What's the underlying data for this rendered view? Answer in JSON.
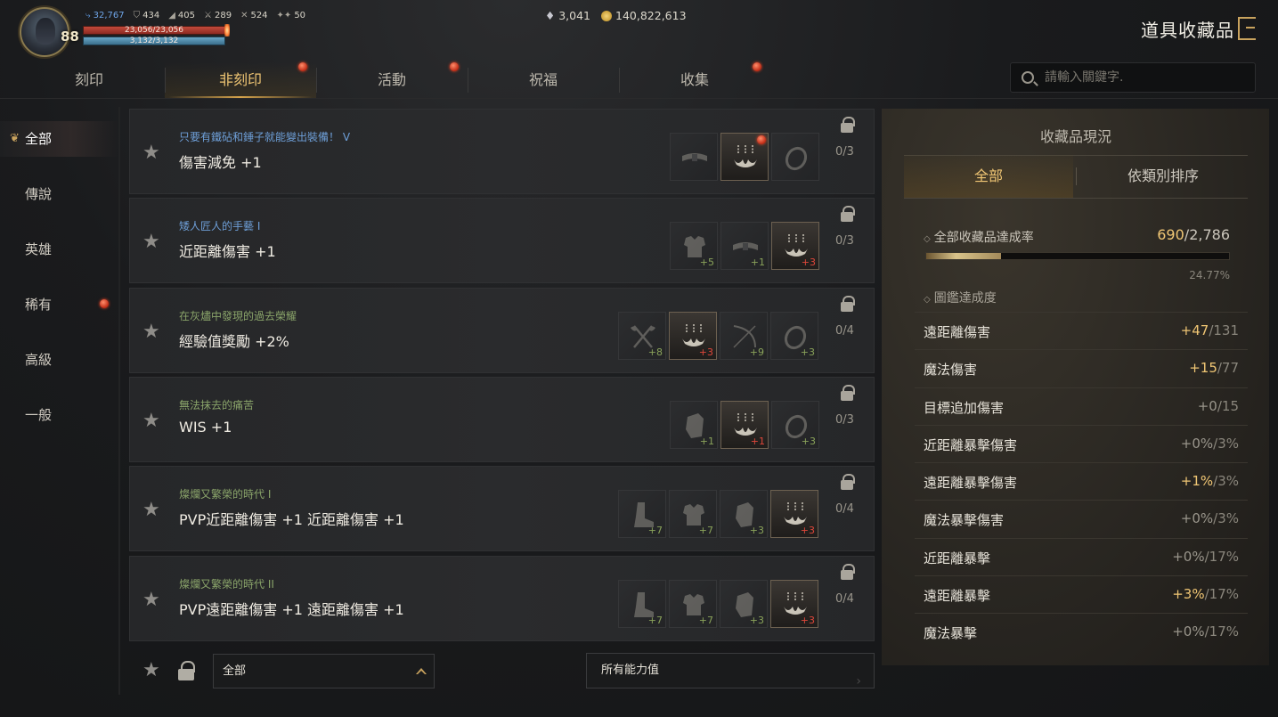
{
  "player": {
    "level": "88",
    "hp_text": "23,056/23,056",
    "mp_text": "3,132/3,132",
    "stats": [
      {
        "icon": "feather-icon",
        "glyph": "⤷",
        "value": "32,767",
        "blue": true
      },
      {
        "icon": "armor-icon",
        "glyph": "⛉",
        "value": "434"
      },
      {
        "icon": "boot-icon",
        "glyph": "◢",
        "value": "405"
      },
      {
        "icon": "swords-icon",
        "glyph": "⚔",
        "value": "289"
      },
      {
        "icon": "crossed-icon",
        "glyph": "✕",
        "value": "524"
      },
      {
        "icon": "stars-icon",
        "glyph": "✦✦",
        "value": "50"
      }
    ]
  },
  "currency": {
    "gem_icon": "diamond-icon",
    "gems": "3,041",
    "gold_icon": "gold-coin-icon",
    "gold": "140,822,613"
  },
  "window": {
    "title": "道具收藏品",
    "exit_icon": "exit-door-icon"
  },
  "tabs": [
    {
      "label": "刻印",
      "active": false,
      "dot": false
    },
    {
      "label": "非刻印",
      "active": true,
      "dot": true
    },
    {
      "label": "活動",
      "active": false,
      "dot": true
    },
    {
      "label": "祝福",
      "active": false,
      "dot": false
    },
    {
      "label": "收集",
      "active": false,
      "dot": true
    }
  ],
  "search": {
    "placeholder": "請輸入關鍵字."
  },
  "sidebar": {
    "items": [
      {
        "label": "全部",
        "active": true
      },
      {
        "label": "傳說"
      },
      {
        "label": "英雄"
      },
      {
        "label": "稀有",
        "dot": true
      },
      {
        "label": "高級"
      },
      {
        "label": "一般"
      }
    ]
  },
  "collections": [
    {
      "subtitle": "只要有鐵砧和錘子就能變出裝備！ V",
      "sub_color": "blue",
      "effect": "傷害減免 +1",
      "count": "0/3",
      "items": [
        {
          "icon": "belt-icon",
          "owned": false
        },
        {
          "icon": "earring-icon",
          "owned": true,
          "dot": true
        },
        {
          "icon": "ring-icon",
          "owned": false
        }
      ]
    },
    {
      "subtitle": "矮人匠人的手藝 I",
      "sub_color": "blue",
      "effect": "近距離傷害 +1",
      "count": "0/3",
      "items": [
        {
          "icon": "armor-icon",
          "owned": false,
          "plus": "+5"
        },
        {
          "icon": "belt-icon",
          "owned": false,
          "plus": "+1"
        },
        {
          "icon": "earring-icon",
          "owned": true,
          "plus": "+3",
          "red": true
        }
      ]
    },
    {
      "subtitle": "在灰燼中發現的過去榮耀",
      "sub_color": "green",
      "effect": "經驗值獎勵 +2%",
      "count": "0/4",
      "items": [
        {
          "icon": "axe-icon",
          "owned": false,
          "plus": "+8"
        },
        {
          "icon": "earring-icon",
          "owned": true,
          "plus": "+3",
          "red": true
        },
        {
          "icon": "bow-icon",
          "owned": false,
          "plus": "+9"
        },
        {
          "icon": "ring-icon",
          "owned": false,
          "plus": "+3"
        }
      ]
    },
    {
      "subtitle": "無法抹去的痛苦",
      "sub_color": "green",
      "effect": "WIS +1",
      "count": "0/3",
      "items": [
        {
          "icon": "gauntlet-icon",
          "owned": false,
          "plus": "+1"
        },
        {
          "icon": "earring-icon",
          "owned": true,
          "plus": "+1",
          "red": true
        },
        {
          "icon": "ring-icon",
          "owned": false,
          "plus": "+3"
        }
      ]
    },
    {
      "subtitle": "燦爛又繁榮的時代 I",
      "sub_color": "green",
      "effect": "PVP近距離傷害 +1 近距離傷害 +1",
      "count": "0/4",
      "items": [
        {
          "icon": "boots-icon",
          "owned": false,
          "plus": "+7"
        },
        {
          "icon": "armor-icon",
          "owned": false,
          "plus": "+7"
        },
        {
          "icon": "gauntlet-icon",
          "owned": false,
          "plus": "+3"
        },
        {
          "icon": "earring-icon",
          "owned": true,
          "plus": "+3",
          "red": true
        }
      ]
    },
    {
      "subtitle": "燦爛又繁榮的時代 II",
      "sub_color": "green",
      "effect": "PVP遠距離傷害 +1 遠距離傷害 +1",
      "count": "0/4",
      "items": [
        {
          "icon": "boots-icon",
          "owned": false,
          "plus": "+7"
        },
        {
          "icon": "armor-icon",
          "owned": false,
          "plus": "+7"
        },
        {
          "icon": "gauntlet-icon",
          "owned": false,
          "plus": "+3"
        },
        {
          "icon": "earring-icon",
          "owned": true,
          "plus": "+3",
          "red": true
        }
      ]
    }
  ],
  "filter": {
    "grade_value": "全部",
    "stat_value": "所有能力值"
  },
  "panel": {
    "title": "收藏品現況",
    "tab_all": "全部",
    "tab_sort": "依類別排序",
    "rate_label": "全部收藏品達成率",
    "rate_have": "690",
    "rate_total": "/2,786",
    "rate_fraction": 0.2477,
    "rate_pct": "24.77%",
    "dex_label": "圖鑑達成度",
    "stats": [
      {
        "name": "遠距離傷害",
        "val": "+47",
        "max": "/131",
        "on": true
      },
      {
        "name": "魔法傷害",
        "val": "+15",
        "max": "/77",
        "on": true
      },
      {
        "name": "目標追加傷害",
        "val": "+0",
        "max": "/15",
        "on": false
      },
      {
        "name": "近距離暴擊傷害",
        "val": "+0%",
        "max": "/3%",
        "on": false
      },
      {
        "name": "遠距離暴擊傷害",
        "val": "+1%",
        "max": "/3%",
        "on": true
      },
      {
        "name": "魔法暴擊傷害",
        "val": "+0%",
        "max": "/3%",
        "on": false
      },
      {
        "name": "近距離暴擊",
        "val": "+0%",
        "max": "/17%",
        "on": false
      },
      {
        "name": "遠距離暴擊",
        "val": "+3%",
        "max": "/17%",
        "on": true
      },
      {
        "name": "魔法暴擊",
        "val": "+0%",
        "max": "/17%",
        "on": false
      }
    ]
  }
}
